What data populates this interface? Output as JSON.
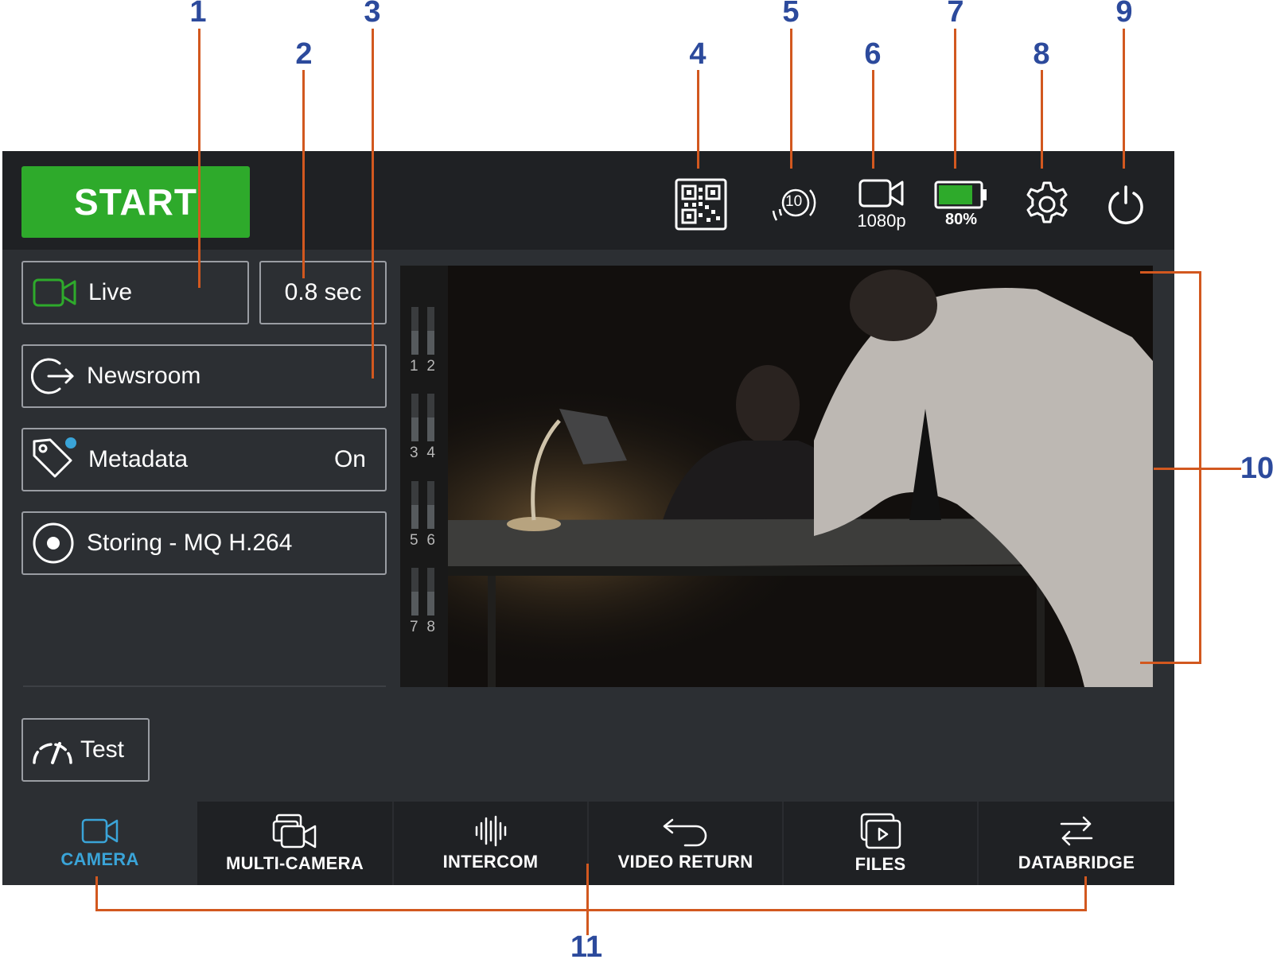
{
  "callouts": [
    "1",
    "2",
    "3",
    "4",
    "5",
    "6",
    "7",
    "8",
    "9",
    "10",
    "11"
  ],
  "header": {
    "start_label": "START",
    "qr_icon": "qr-code-icon",
    "streams_badge": "10",
    "resolution_label": "1080p",
    "battery_label": "80%",
    "battery_level": 0.8,
    "settings_icon": "gear-icon",
    "power_icon": "power-icon"
  },
  "controls": {
    "mode_label": "Live",
    "latency_label": "0.8 sec",
    "destination_label": "Newsroom",
    "metadata_label": "Metadata",
    "metadata_value": "On",
    "storing_label": "Storing - MQ H.264",
    "test_label": "Test"
  },
  "audio_meters": [
    "1",
    "2",
    "3",
    "4",
    "5",
    "6",
    "7",
    "8"
  ],
  "tabs": [
    {
      "label": "CAMERA",
      "icon": "camera-icon",
      "active": true
    },
    {
      "label": "MULTI-CAMERA",
      "icon": "multi-camera-icon",
      "active": false
    },
    {
      "label": "INTERCOM",
      "icon": "waveform-icon",
      "active": false
    },
    {
      "label": "VIDEO RETURN",
      "icon": "return-arrow-icon",
      "active": false
    },
    {
      "label": "FILES",
      "icon": "files-icon",
      "active": false
    },
    {
      "label": "DATABRIDGE",
      "icon": "swap-arrows-icon",
      "active": false
    }
  ],
  "colors": {
    "start_green": "#2eaa2b",
    "active_tab_blue": "#3aa4d8",
    "callout_blue": "#2c4a9c",
    "callout_line_orange": "#d2581f",
    "metadata_dot_blue": "#3aa4d8"
  }
}
